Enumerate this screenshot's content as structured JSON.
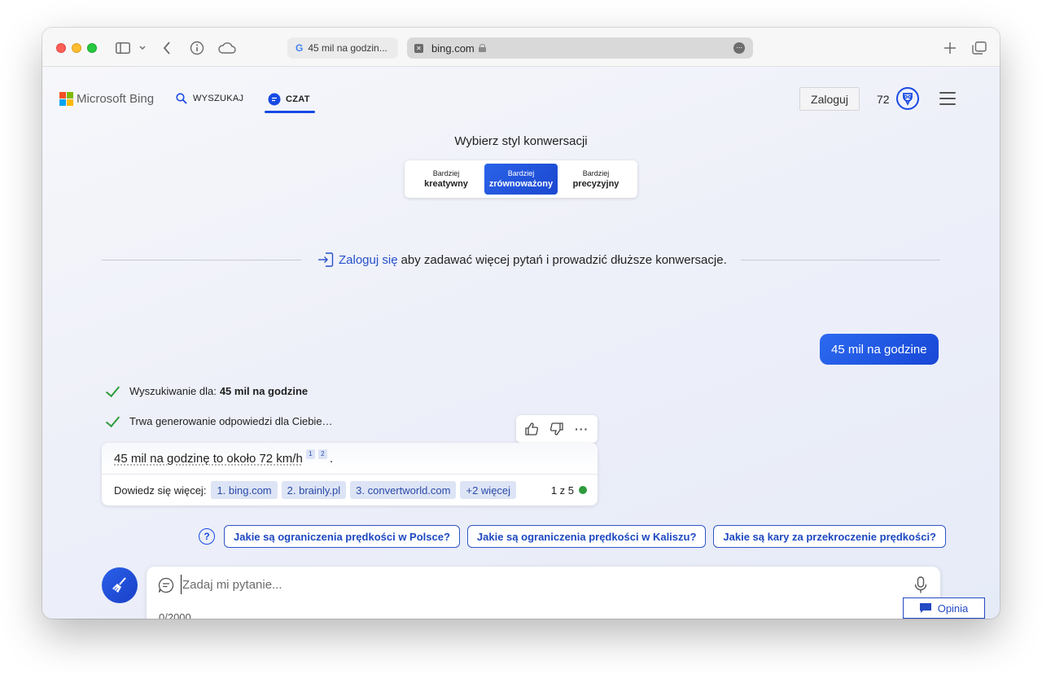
{
  "browser": {
    "tabs": [
      {
        "title": "45 mil na godzin...",
        "favicon": "google-icon"
      },
      {
        "title": "bing.com",
        "favicon": "bing-favicon"
      }
    ],
    "icons": [
      "sidebar-icon",
      "chevron-down-icon",
      "back-arrow-icon",
      "info-icon",
      "cloud-icon",
      "new-tab-plus-icon",
      "tab-overview-icon"
    ]
  },
  "header": {
    "brand": "Microsoft Bing",
    "nav": {
      "search": "WYSZUKAJ",
      "chat": "CZAT"
    },
    "login": "Zaloguj",
    "points": "72"
  },
  "style_picker": {
    "title": "Wybierz styl konwersacji",
    "options": [
      {
        "line1": "Bardziej",
        "line2": "kreatywny"
      },
      {
        "line1": "Bardziej",
        "line2": "zrównoważony",
        "active": true
      },
      {
        "line1": "Bardziej",
        "line2": "precyzyjny"
      }
    ]
  },
  "signin": {
    "link": "Zaloguj się",
    "text": "aby zadawać więcej pytań i prowadzić dłuższe konwersacje."
  },
  "user_message": "45 mil na godzine",
  "status": {
    "searching_label": "Wyszukiwanie dla:",
    "searching_query": "45 mil na godzine",
    "generating": "Trwa generowanie odpowiedzi dla Ciebie…"
  },
  "answer": {
    "text": "45 mil na godzinę to około 72 km/h",
    "citations": [
      "1",
      "2"
    ],
    "end": ".",
    "learn_more": "Dowiedz się więcej:",
    "sources": [
      "1. bing.com",
      "2. brainly.pl",
      "3. convertworld.com",
      "+2 więcej"
    ],
    "page": "1 z 5"
  },
  "suggestions": [
    "Jakie są ograniczenia prędkości w Polsce?",
    "Jakie są ograniczenia prędkości w Kaliszu?",
    "Jakie są kary za przekroczenie prędkości?"
  ],
  "composer": {
    "placeholder": "Zadaj mi pytanie...",
    "counter": "0/2000"
  },
  "feedback": "Opinia",
  "colors": {
    "accent": "#174ae4",
    "success": "#2e9b3a"
  }
}
